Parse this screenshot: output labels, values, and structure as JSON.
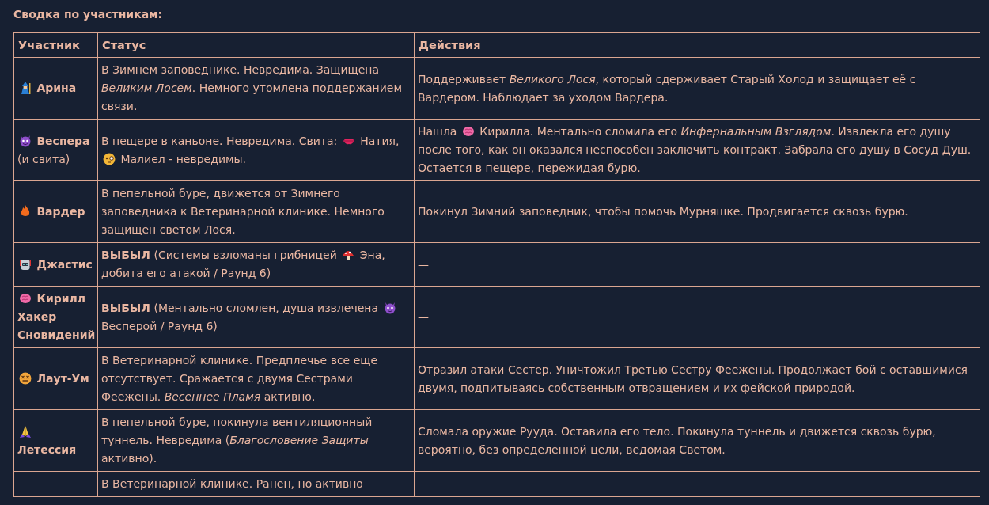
{
  "heading": "Сводка по участникам:",
  "columns": [
    "Участник",
    "Статус",
    "Действия"
  ],
  "rows": [
    {
      "participant": [
        {
          "kind": "wizard"
        },
        {
          "kind": "name",
          "text": "Арина"
        }
      ],
      "status": [
        {
          "kind": "text",
          "text": "В Зимнем заповеднике. Невредима. Защищена *Великим Лосем*. Немного утомлена поддержанием связи."
        }
      ],
      "actions": [
        {
          "kind": "text",
          "text": "Поддерживает *Великого Лося*, который сдерживает Старый Холод и защищает её с Вардером. Наблюдает за уходом Вардера."
        }
      ]
    },
    {
      "participant": [
        {
          "kind": "devil"
        },
        {
          "kind": "name",
          "text": "Веспера"
        },
        {
          "kind": "text",
          "text": "(и свита)"
        }
      ],
      "status": [
        {
          "kind": "text",
          "text": "В пещере в каньоне. Невредима. Свита:"
        },
        {
          "kind": "lips"
        },
        {
          "kind": "text",
          "text": "Натия,"
        },
        {
          "kind": "monocle"
        },
        {
          "kind": "text",
          "text": "Малиел - невредимы."
        }
      ],
      "actions": [
        {
          "kind": "text",
          "text": "Нашла"
        },
        {
          "kind": "brain"
        },
        {
          "kind": "text",
          "text": "Кирилла. Ментально сломила его *Инфернальным Взглядом*. Извлекла его душу после того, как он оказался неспособен заключить контракт. Забрала его душу в Сосуд Душ. Остается в пещере, пережидая бурю."
        }
      ]
    },
    {
      "participant": [
        {
          "kind": "fire"
        },
        {
          "kind": "name",
          "text": "Вардер"
        }
      ],
      "status": [
        {
          "kind": "text",
          "text": "В пепельной буре, движется от Зимнего заповедника к Ветеринарной клинике. Немного защищен светом Лося."
        }
      ],
      "actions": [
        {
          "kind": "text",
          "text": "Покинул Зимний заповедник, чтобы помочь Мурняшке. Продвигается сквозь бурю."
        }
      ]
    },
    {
      "participant": [
        {
          "kind": "robot"
        },
        {
          "kind": "name",
          "text": "Джастис"
        }
      ],
      "status": [
        {
          "kind": "text",
          "text": "**ВЫБЫЛ** (Системы взломаны грибницей"
        },
        {
          "kind": "mushroom"
        },
        {
          "kind": "text",
          "text": "Эна, добита его атакой / Раунд 6)"
        }
      ],
      "actions": [
        {
          "kind": "text",
          "text": "—"
        }
      ]
    },
    {
      "participant": [
        {
          "kind": "brain"
        },
        {
          "kind": "name",
          "text": "Кирилл Хакер Сновидений"
        }
      ],
      "status": [
        {
          "kind": "text",
          "text": "**ВЫБЫЛ** (Ментально сломлен, душа извлечена"
        },
        {
          "kind": "devil"
        },
        {
          "kind": "text",
          "text": "Весперой / Раунд 6)"
        }
      ],
      "actions": [
        {
          "kind": "text",
          "text": "—"
        }
      ]
    },
    {
      "participant": [
        {
          "kind": "dizzy"
        },
        {
          "kind": "name",
          "text": "Лаут-Ум"
        }
      ],
      "status": [
        {
          "kind": "text",
          "text": "В Ветеринарной клинике. Предплечье все еще отсутствует. Сражается с двумя Сестрами Феежены. *Весеннее Пламя* активно."
        }
      ],
      "actions": [
        {
          "kind": "text",
          "text": "Отразил атаки Сестер. Уничтожил Третью Сестру Феежены. Продолжает бой с оставшимися двумя, подпитываясь собственным отвращением и их фейской природой."
        }
      ]
    },
    {
      "participant": [
        {
          "kind": "pray"
        },
        {
          "kind": "name",
          "text": "Летессия"
        }
      ],
      "status": [
        {
          "kind": "text",
          "text": "В пепельной буре, покинула вентиляционный туннель. Невредима (*Благословение Защиты* активно)."
        }
      ],
      "actions": [
        {
          "kind": "text",
          "text": "Сломала оружие Рууда. Оставила его тело. Покинула туннель и движется сквозь бурю, вероятно, без определенной цели, ведомая Светом."
        }
      ]
    },
    {
      "participant": [],
      "status": [
        {
          "kind": "text",
          "text": "В Ветеринарной клинике. Ранен, но активно"
        }
      ],
      "actions": []
    }
  ]
}
